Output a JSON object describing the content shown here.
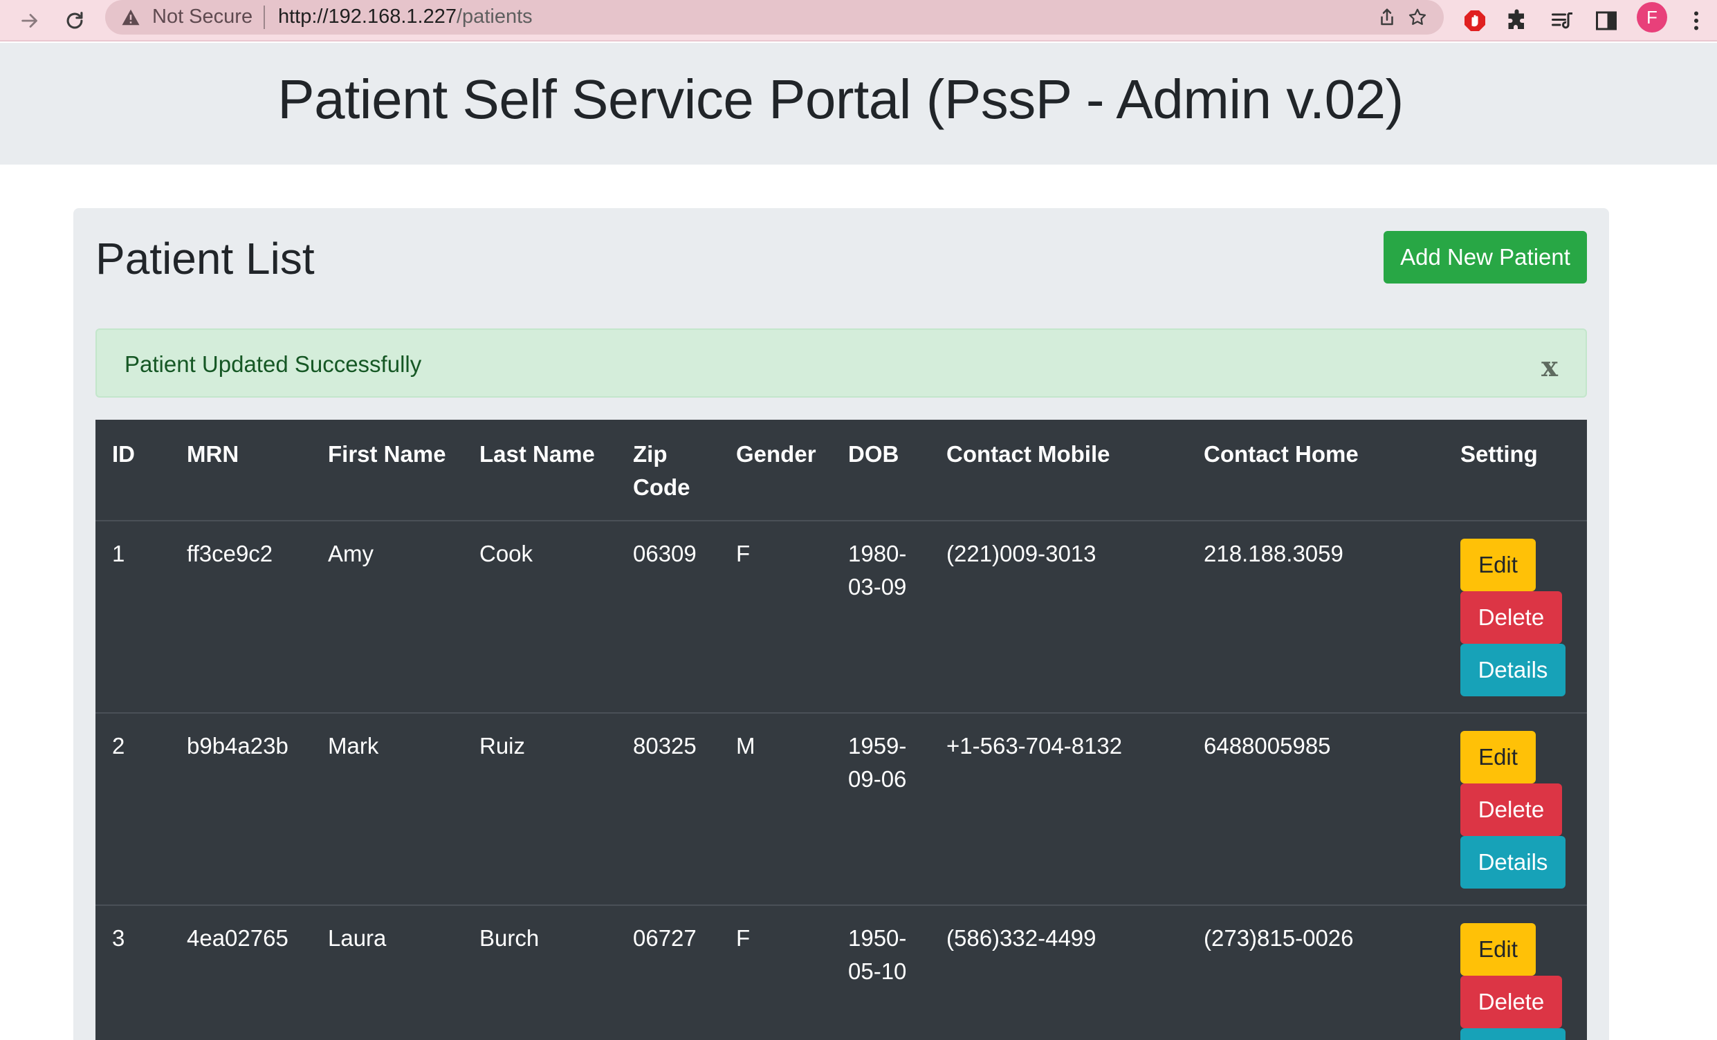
{
  "browser": {
    "security_label": "Not Secure",
    "url_host": "http://192.168.1.227",
    "url_path": "/patients",
    "profile_initial": "F"
  },
  "page": {
    "title": "Patient Self Service Portal (PssP - Admin v.02)"
  },
  "card": {
    "heading": "Patient List",
    "add_button_label": "Add New Patient",
    "alert_message": "Patient Updated Successfully",
    "alert_close_label": "x"
  },
  "table": {
    "headers": {
      "id": "ID",
      "mrn": "MRN",
      "first_name": "First Name",
      "last_name": "Last Name",
      "zip_line1": "Zip",
      "zip_line2": "Code",
      "gender": "Gender",
      "dob": "DOB",
      "contact_mobile": "Contact Mobile",
      "contact_home": "Contact Home",
      "setting": "Setting"
    },
    "rows": [
      {
        "id": "1",
        "mrn": "ff3ce9c2",
        "first_name": "Amy",
        "last_name": "Cook",
        "zip": "06309",
        "gender": "F",
        "dob_line1": "1980-",
        "dob_line2": "03-09",
        "mobile": "(221)009-3013",
        "home": "218.188.3059"
      },
      {
        "id": "2",
        "mrn": "b9b4a23b",
        "first_name": "Mark",
        "last_name": "Ruiz",
        "zip": "80325",
        "gender": "M",
        "dob_line1": "1959-",
        "dob_line2": "09-06",
        "mobile": "+1-563-704-8132",
        "home": "6488005985"
      },
      {
        "id": "3",
        "mrn": "4ea02765",
        "first_name": "Laura",
        "last_name": "Burch",
        "zip": "06727",
        "gender": "F",
        "dob_line1": "1950-",
        "dob_line2": "05-10",
        "mobile": "(586)332-4499",
        "home": "(273)815-0026"
      }
    ],
    "actions": {
      "edit": "Edit",
      "delete": "Delete",
      "details": "Details"
    }
  },
  "colors": {
    "browser_bar": "#f7dde3",
    "jumbotron": "#e9ecef",
    "table_dark": "#343a40",
    "success": "#28a745",
    "warning": "#ffc107",
    "danger": "#dc3545",
    "info": "#17a2b8",
    "alert_bg": "#d4edda",
    "alert_text": "#155724"
  },
  "icons": [
    "forward-arrow-icon",
    "reload-icon",
    "warning-icon",
    "share-icon",
    "star-icon",
    "adblock-icon",
    "extensions-puzzle-icon",
    "reading-list-icon",
    "side-panel-icon",
    "kebab-menu-icon"
  ]
}
